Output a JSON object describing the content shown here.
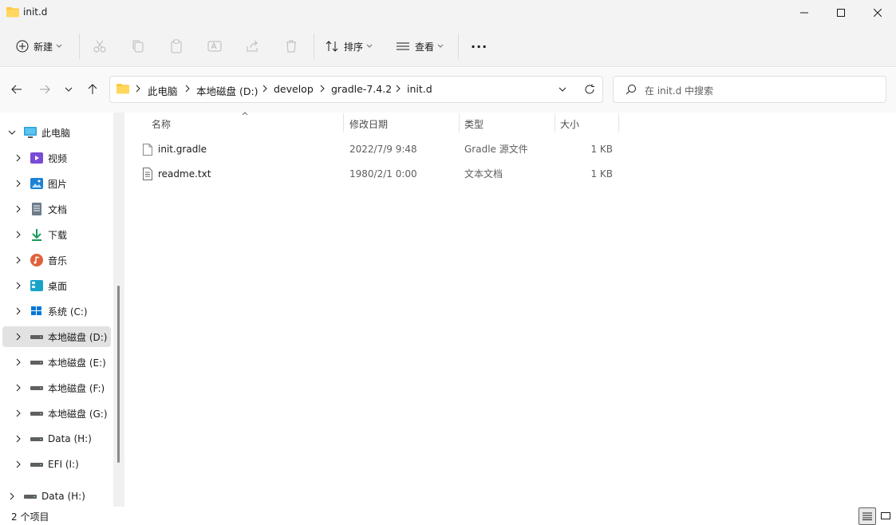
{
  "window": {
    "title": "init.d"
  },
  "commandbar": {
    "new_label": "新建",
    "sort_label": "排序",
    "view_label": "查看",
    "more_label": "···"
  },
  "breadcrumb": [
    "此电脑",
    "本地磁盘 (D:)",
    "develop",
    "gradle-7.4.2",
    "init.d"
  ],
  "search": {
    "placeholder": "在 init.d 中搜索"
  },
  "nav": {
    "items": [
      {
        "label": "此电脑",
        "icon": "monitor-icon"
      },
      {
        "label": "视频",
        "icon": "video-icon"
      },
      {
        "label": "图片",
        "icon": "pictures-icon"
      },
      {
        "label": "文档",
        "icon": "document-icon"
      },
      {
        "label": "下载",
        "icon": "download-icon"
      },
      {
        "label": "音乐",
        "icon": "music-icon"
      },
      {
        "label": "桌面",
        "icon": "desktop-icon"
      },
      {
        "label": "系统 (C:)",
        "icon": "windows-drive-icon"
      },
      {
        "label": "本地磁盘 (D:)",
        "icon": "drive-icon"
      },
      {
        "label": "本地磁盘 (E:)",
        "icon": "drive-icon"
      },
      {
        "label": "本地磁盘 (F:)",
        "icon": "drive-icon"
      },
      {
        "label": "本地磁盘 (G:)",
        "icon": "drive-icon"
      },
      {
        "label": "Data (H:)",
        "icon": "drive-icon"
      },
      {
        "label": "EFI (I:)",
        "icon": "drive-icon"
      },
      {
        "label": "Data (H:)",
        "icon": "drive-icon"
      }
    ]
  },
  "columns": {
    "name": "名称",
    "modified": "修改日期",
    "type": "类型",
    "size": "大小"
  },
  "files": [
    {
      "name": "init.gradle",
      "modified": "2022/7/9 9:48",
      "type": "Gradle 源文件",
      "size": "1 KB"
    },
    {
      "name": "readme.txt",
      "modified": "1980/2/1 0:00",
      "type": "文本文档",
      "size": "1 KB"
    }
  ],
  "status": {
    "item_count": "2 个项目"
  },
  "colors": {
    "folder": "#ffc83d",
    "accent": "#0067c0",
    "selected": "#e2e2e2"
  }
}
